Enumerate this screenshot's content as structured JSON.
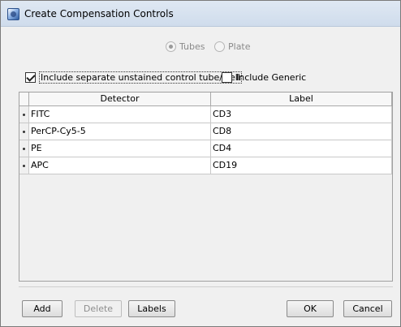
{
  "window": {
    "title": "Create Compensation Controls",
    "icon": "app-window-icon"
  },
  "mode": {
    "options": [
      {
        "label": "Tubes",
        "checked": true,
        "enabled": false
      },
      {
        "label": "Plate",
        "checked": false,
        "enabled": false
      }
    ]
  },
  "options": {
    "unstained_label": "Include separate unstained control tube/well",
    "unstained_checked": true,
    "generic_label": "Include Generic",
    "generic_checked": false
  },
  "table": {
    "columns": [
      "Detector",
      "Label"
    ],
    "rows": [
      {
        "detector": "FITC",
        "label": "CD3"
      },
      {
        "detector": "PerCP-Cy5-5",
        "label": "CD8"
      },
      {
        "detector": "PE",
        "label": "CD4"
      },
      {
        "detector": "APC",
        "label": "CD19"
      }
    ]
  },
  "buttons": {
    "add": "Add",
    "delete": "Delete",
    "labels": "Labels",
    "ok": "OK",
    "cancel": "Cancel"
  }
}
